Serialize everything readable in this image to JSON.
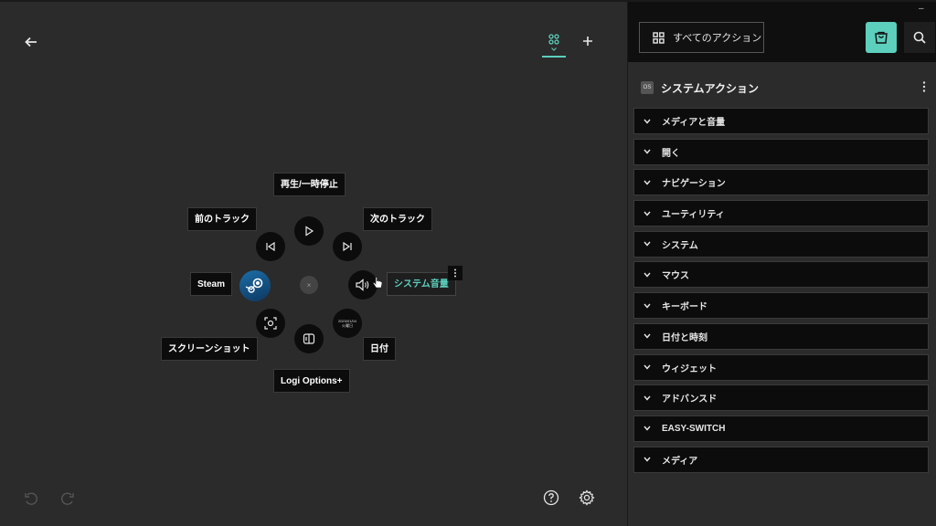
{
  "radial": {
    "play_pause": "再生/一時停止",
    "prev_track": "前のトラック",
    "next_track": "次のトラック",
    "steam": "Steam",
    "system_volume": "システム音量",
    "screenshot": "スクリーンショット",
    "date": "日付",
    "logi_options": "Logi Options+",
    "center": "×",
    "date_icon_line1": "2023/01/04",
    "date_icon_line2": "火曜日"
  },
  "panel": {
    "all_actions": "すべてのアクション",
    "section_badge": "OS",
    "section_title": "システムアクション",
    "categories": [
      "メディアと音量",
      "開く",
      "ナビゲーション",
      "ユーティリティ",
      "システム",
      "マウス",
      "キーボード",
      "日付と時刻",
      "ウィジェット",
      "アドバンスド",
      "EASY-SWITCH",
      "メディア"
    ]
  },
  "colors": {
    "accent": "#5ccfbd",
    "background": "#2b2b2b",
    "node": "#0c0c0c"
  },
  "icons": [
    "back-arrow-icon",
    "grid-icon",
    "plus-icon",
    "undo-icon",
    "redo-icon",
    "help-icon",
    "gear-icon",
    "play-icon",
    "prev-icon",
    "next-icon",
    "steam-icon",
    "volume-icon",
    "screenshot-icon",
    "logi-icon",
    "calendar-icon",
    "store-icon",
    "search-icon",
    "chevron-down-icon",
    "more-vertical-icon"
  ]
}
